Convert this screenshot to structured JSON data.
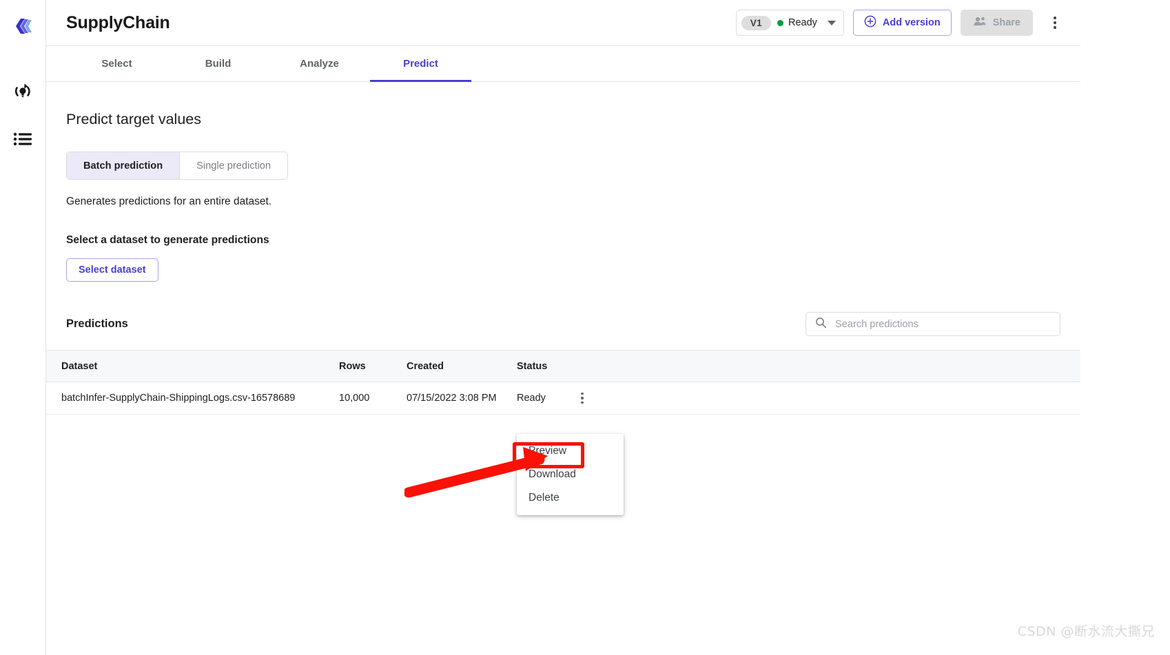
{
  "rail": {
    "items": [
      {
        "name": "app-logo",
        "icon": "layers-logo-icon"
      },
      {
        "name": "model-icon",
        "icon": "model-rotate-bulb-icon"
      },
      {
        "name": "list-icon",
        "icon": "list-icon"
      }
    ]
  },
  "header": {
    "title": "SupplyChain",
    "version_label": "V1",
    "status_label": "Ready",
    "status_color": "#0b9b3f",
    "add_version_label": "Add version",
    "share_label": "Share",
    "more_icon": "kebab-menu-icon"
  },
  "tabs": [
    {
      "label": "Select",
      "active": false
    },
    {
      "label": "Build",
      "active": false
    },
    {
      "label": "Analyze",
      "active": false
    },
    {
      "label": "Predict",
      "active": true
    }
  ],
  "content": {
    "page_title": "Predict target values",
    "segmented": [
      {
        "label": "Batch prediction",
        "active": true
      },
      {
        "label": "Single prediction",
        "active": false
      }
    ],
    "helper_text": "Generates predictions for an entire dataset.",
    "section_label": "Select a dataset to generate predictions",
    "select_dataset_label": "Select dataset"
  },
  "predictions": {
    "title": "Predictions",
    "search_placeholder": "Search predictions",
    "search_value": "",
    "search_icon": "search-icon",
    "columns": [
      "Dataset",
      "Rows",
      "Created",
      "Status"
    ],
    "rows": [
      {
        "dataset": "batchInfer-SupplyChain-ShippingLogs.csv-16578689",
        "rows": "10,000",
        "created": "07/15/2022 3:08 PM",
        "status": "Ready"
      }
    ]
  },
  "row_menu": {
    "items": [
      "Preview",
      "Download",
      "Delete"
    ],
    "highlighted": "Preview"
  },
  "annotation": {
    "color": "#fb1105",
    "target": "Preview"
  },
  "watermark": {
    "text": "CSDN @断水流大撕兄"
  },
  "theme": {
    "accent": "#4a3fd4",
    "accent_soft": "#eceaf9",
    "border": "#e3e5e8"
  }
}
